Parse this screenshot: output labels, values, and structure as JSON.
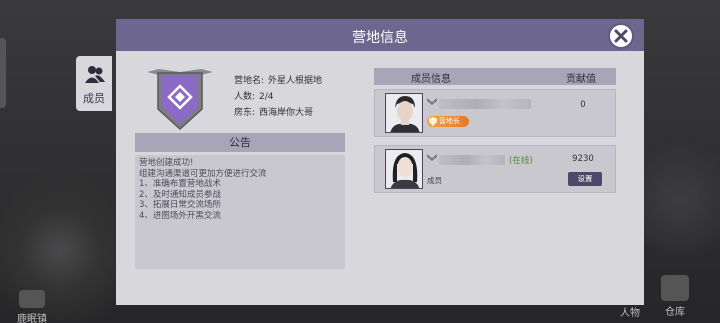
{
  "scene": {
    "left_button_label": "鹿眠镇",
    "right_button_1_label": "人物",
    "right_button_2_label": "仓库"
  },
  "dialog": {
    "title": "营地信息"
  },
  "side_tab": {
    "label": "成员",
    "icon": "people-icon"
  },
  "camp": {
    "name_label": "营地名:",
    "name_value": "外星人根据地",
    "count_label": "人数:",
    "count_value": "2/4",
    "owner_label": "房东:",
    "owner_value": "西海岸你大哥"
  },
  "notice": {
    "title": "公告",
    "lines": [
      "营地创建成功!",
      "组建沟通渠道可更加方便进行交流",
      "1、准确布置营地战术",
      "2、及时通知成员参战",
      "3、拓展日常交流场所",
      "4、进图场外开黑交流"
    ]
  },
  "members": {
    "header_name": "成员信息",
    "header_contribution": "贡献值",
    "list": [
      {
        "role": "营地长",
        "online": "",
        "contribution": "0",
        "action": ""
      },
      {
        "role": "成员",
        "online": "(在线)",
        "contribution": "9230",
        "action": "设置"
      }
    ]
  },
  "colors": {
    "title_bar": "#6d678f",
    "panel": "#d8d7db",
    "emblem": "#8c6bc7",
    "online": "#4d8a3c",
    "leader_badge": "#e8882f"
  }
}
